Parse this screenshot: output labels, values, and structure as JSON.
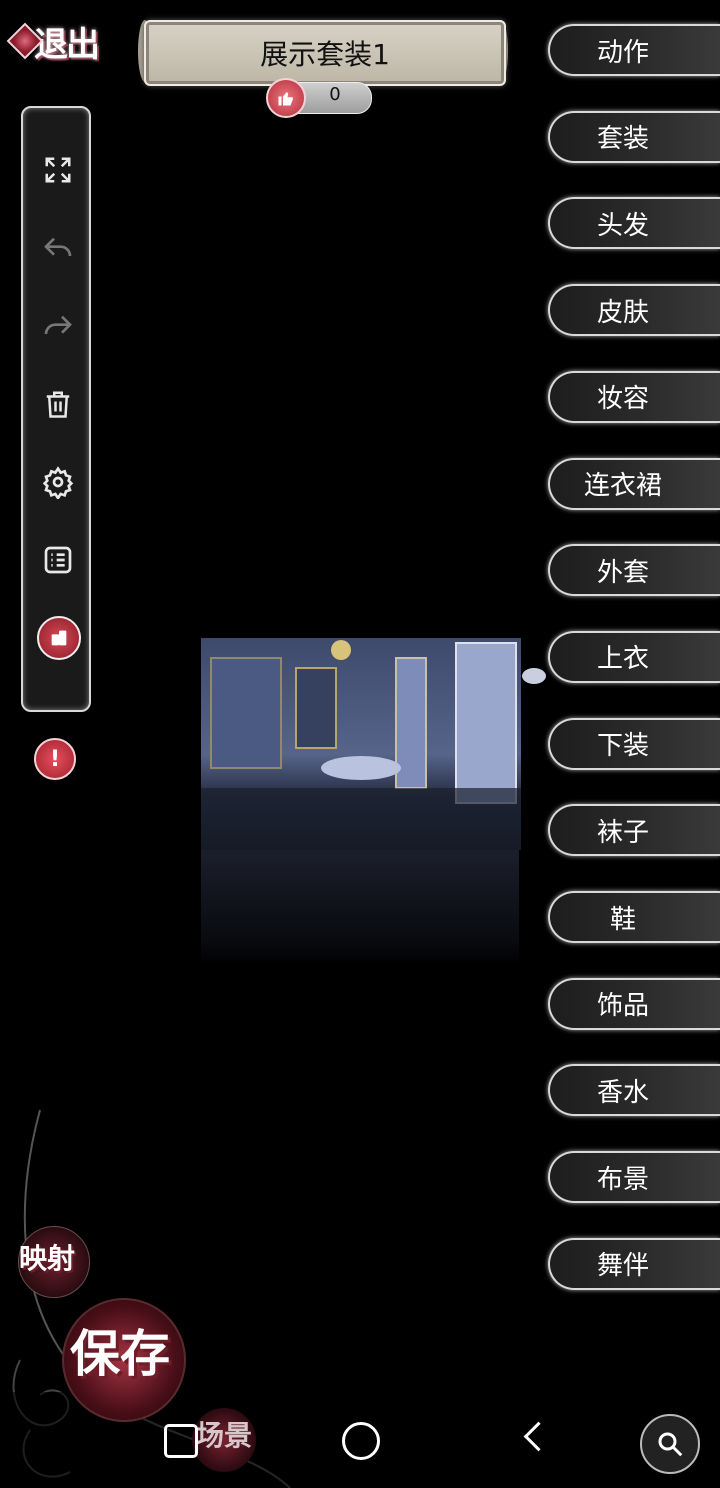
{
  "exit": {
    "label": "退出"
  },
  "title": {
    "text": "展示套装1"
  },
  "likes": {
    "count": "0"
  },
  "toolbar": {
    "icons": [
      "expand-icon",
      "undo-icon",
      "redo-icon",
      "trash-icon",
      "settings-icon",
      "list-icon",
      "switch-icon"
    ]
  },
  "categories": [
    "动作",
    "套装",
    "头发",
    "皮肤",
    "妆容",
    "连衣裙",
    "外套",
    "上衣",
    "下装",
    "袜子",
    "鞋",
    "饰品",
    "香水",
    "布景",
    "舞伴"
  ],
  "bottom": {
    "map_label": "映射",
    "save_label": "保存",
    "scene_label": "场景"
  },
  "colors": {
    "accent": "#b82d3a",
    "banner": "#cfc9bb"
  }
}
